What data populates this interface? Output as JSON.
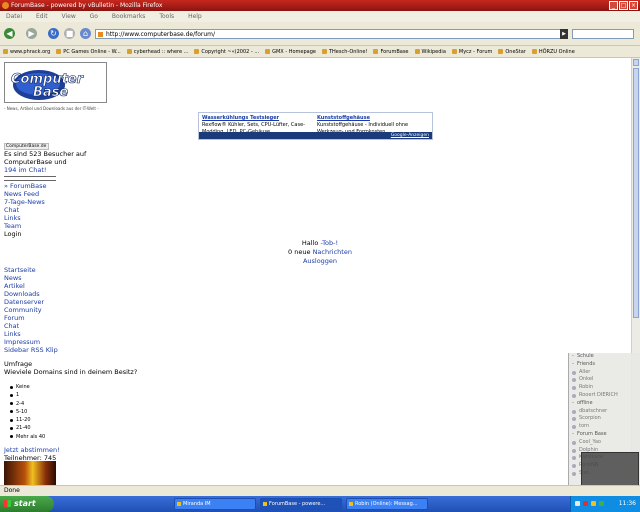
{
  "window": {
    "title": "ForumBase - powered by vBulletin - Mozilla Firefox"
  },
  "menu": [
    "Datei",
    "Edit",
    "View",
    "Go",
    "Bookmarks",
    "Tools",
    "Help"
  ],
  "nav": {
    "url": "http://www.computerbase.de/forum/"
  },
  "bookmarks": [
    "www.phrack.org",
    "PC Games Online - W...",
    "cyberhead :: where ...",
    "Copyright ~«(2002 - ...",
    "GMX - Homepage",
    "THesch-Online!",
    "ForumBase",
    "Wikipedia",
    "Mycz - Forum",
    "OneStar",
    "HÖRZU Online"
  ],
  "page": {
    "logo_line1": "Computer",
    "logo_line2": "Base",
    "tagline": "- News, Artikel und Downloads aus der IT-Welt -",
    "ad": {
      "left_title": "Wasserkühlungs Testsieger",
      "left_text": "Rexflow® Kühler, Sets, CPU-Lüfter, Case-Modding, LED, PC-Gehäuse,",
      "right_title": "Kunststoffgehäuse",
      "right_text": "Kunststoffgehäuse - Individuell ohne Werkzeug- und Formkosten",
      "google": "Google-Anzeigen"
    },
    "cbox_label": "ComputerBase.de",
    "visitors_pre": "Es sind 523 Besucher auf ComputerBase und",
    "visitors_link": "194 im Chat!",
    "links1": [
      "» ForumBase",
      "News Feed",
      "7-Tage-News",
      "Chat",
      "Links",
      "Team"
    ],
    "login": "Login",
    "hello_pre": "Hallo",
    "hello_user": "-Tob-!",
    "messages_pre": "0 neue",
    "messages_link": "Nachrichten",
    "logout": "Ausloggen",
    "links2": [
      "Startseite",
      "News",
      "Artikel",
      "Downloads",
      "Datenserver",
      "Community",
      "Forum",
      "Chat",
      "Links",
      "Impressum",
      "Sidebar RSS Klip"
    ],
    "poll_title": "Umfrage",
    "poll_question": "Wieviele Domains sind in deinem Besitz?",
    "poll_options": [
      "Keine",
      "1",
      "2-4",
      "5-10",
      "11-20",
      "21-40",
      "Mehr als 40"
    ],
    "vote_link": "Jetzt abstimmen!",
    "participants": "Teilnehmer: 745"
  },
  "status": "Done",
  "taskbar": {
    "start": "start",
    "buttons": [
      "Miranda IM",
      "ForumBase - powere...",
      "Robin (Online): Messag..."
    ],
    "clock": "11:36"
  },
  "miranda": [
    {
      "t": "Schule",
      "g": true
    },
    {
      "t": "Friends",
      "g": true
    },
    {
      "t": "Aller"
    },
    {
      "t": "Onkel"
    },
    {
      "t": "Robin"
    },
    {
      "t": "Rooert DIERICH"
    },
    {
      "t": "offline",
      "g": true
    },
    {
      "t": "dbatschner"
    },
    {
      "t": "Scorpion"
    },
    {
      "t": "torn"
    },
    {
      "t": "Forum Base",
      "g": true
    },
    {
      "t": "Cool_Yao"
    },
    {
      "t": "Dolphin"
    },
    {
      "t": "Kamikaze"
    },
    {
      "t": "RockNN"
    },
    {
      "t": "Siet..."
    }
  ]
}
